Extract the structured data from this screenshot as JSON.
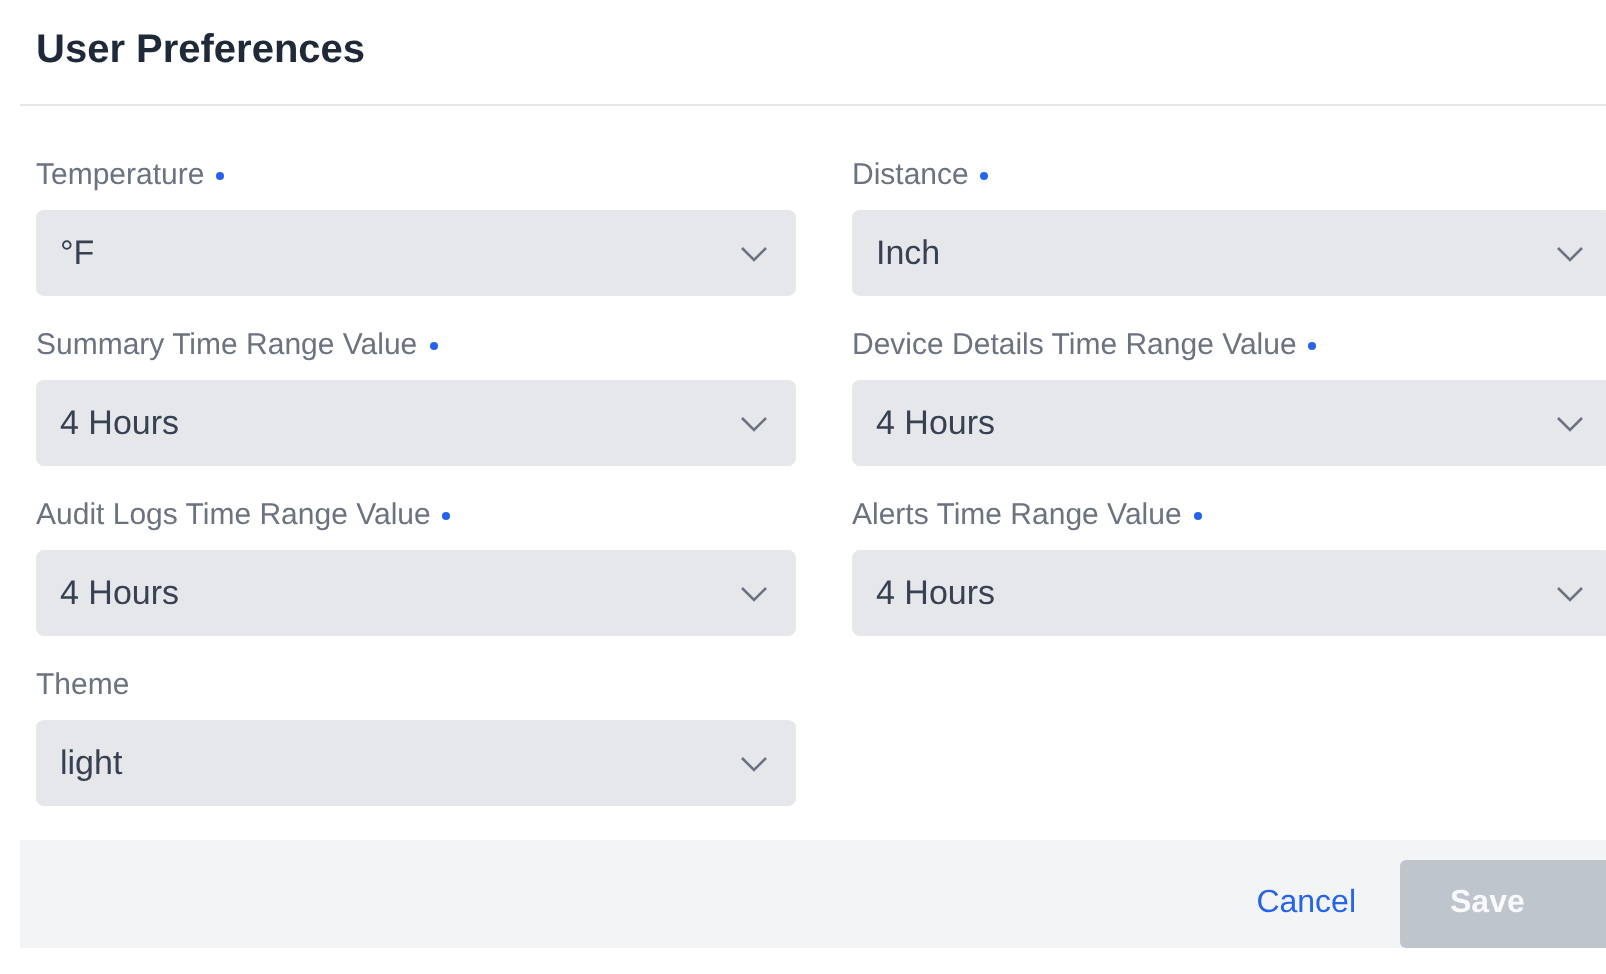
{
  "title": "User Preferences",
  "fields": [
    {
      "label": "Temperature",
      "required": true,
      "value": "°F"
    },
    {
      "label": "Distance",
      "required": true,
      "value": "Inch"
    },
    {
      "label": "Summary Time Range Value",
      "required": true,
      "value": "4 Hours"
    },
    {
      "label": "Device Details Time Range Value",
      "required": true,
      "value": "4 Hours"
    },
    {
      "label": "Audit Logs Time Range Value",
      "required": true,
      "value": "4 Hours"
    },
    {
      "label": "Alerts Time Range Value",
      "required": true,
      "value": "4 Hours"
    },
    {
      "label": "Theme",
      "required": false,
      "value": "light"
    }
  ],
  "footer": {
    "cancel": "Cancel",
    "save": {
      "label": "Save",
      "disabled": true
    }
  }
}
